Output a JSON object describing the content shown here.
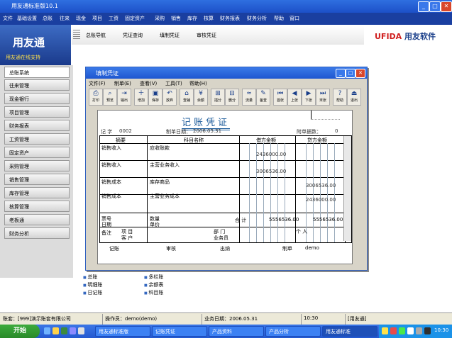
{
  "app": {
    "title": "用友通标准版10.1"
  },
  "menubar": [
    "文件",
    "基础设置",
    "总账",
    "往来",
    "现金",
    "项目",
    "工资",
    "固定资产",
    "采购",
    "销售",
    "库存",
    "核算",
    "财务报表",
    "财务分析",
    "帮助",
    "窗口"
  ],
  "logo": {
    "name": "用友通",
    "slogan": "用友通在线支持"
  },
  "tabs": [
    "总账导航",
    "凭证查询",
    "填制凭证",
    "审核凭证"
  ],
  "brand": {
    "en": "UFIDA",
    "cn": "用友软件"
  },
  "nav": [
    "总账系统",
    "往来管理",
    "现金银行",
    "项目管理",
    "财务报表",
    "工资管理",
    "固定资产",
    "采购管理",
    "销售管理",
    "库存管理",
    "核算管理",
    "老板通",
    "财务分析"
  ],
  "links": [
    "账簿查询",
    "总账",
    "明细账",
    "日记账",
    "多栏账",
    "余额表",
    "科目账",
    "辅助账"
  ],
  "voucher_window": {
    "title": "填制凭证",
    "menu": [
      "文件(F)",
      "制单(E)",
      "查看(V)",
      "工具(T)",
      "帮助(H)"
    ],
    "toolbar": [
      "打印",
      "预览",
      "输出",
      "增加",
      "保存",
      "放弃",
      "查辅",
      "余额",
      "插分",
      "删分",
      "流量",
      "备查",
      "首张",
      "上张",
      "下张",
      "末张",
      "帮助",
      "退出"
    ],
    "heading": "记账凭证",
    "voucher_no_label": "记 字",
    "voucher_no": "0002",
    "date_label": "制单日期：",
    "date": "2006.05.31",
    "attach_label": "附单据数：",
    "attach": "0",
    "col_summary": "摘要",
    "col_account": "科目名称",
    "col_debit": "借方金额",
    "col_credit": "贷方金额",
    "rows": [
      {
        "summary": "销售收入",
        "account": "应收账款",
        "debit": "2436000.00",
        "credit": ""
      },
      {
        "summary": "销售收入",
        "account": "主营业务收入",
        "debit": "",
        "credit": ""
      },
      {
        "summary": "销售成本",
        "account": "库存商品",
        "debit": "",
        "credit": ""
      },
      {
        "summary": "销售成本",
        "account": "主营业务成本",
        "debit": "",
        "credit": "2436000.00"
      }
    ],
    "debit_left": "2436000.00",
    "debit_2": "3006536.00",
    "credit_1": "3006536.00",
    "credit_2": "2436000.00",
    "total_label": "合 计",
    "total_debit": "5556536.00",
    "total_credit": "5556536.00",
    "foot_labels": [
      "票号",
      "日期",
      "数量",
      "单价",
      "备注",
      "项 目",
      "客 户",
      "部 门",
      "业务员",
      "个 人"
    ],
    "signers": [
      "记账",
      "审核",
      "出纳",
      "制单"
    ],
    "maker": "demo"
  },
  "status": [
    "账套：[999]演示账套有限公司",
    "操作员：demo(demo)",
    "业务日期：2006.05.31",
    "10:30",
    "[用友通]"
  ],
  "taskbar": {
    "start": "开始",
    "tasks": [
      "用友通标准版",
      "记账凭证",
      "产品资料",
      "产品分析",
      "用友通标准"
    ],
    "clock": "10:30"
  },
  "colors": {
    "accent": "#1a3fa0",
    "brand": "#d02020"
  }
}
